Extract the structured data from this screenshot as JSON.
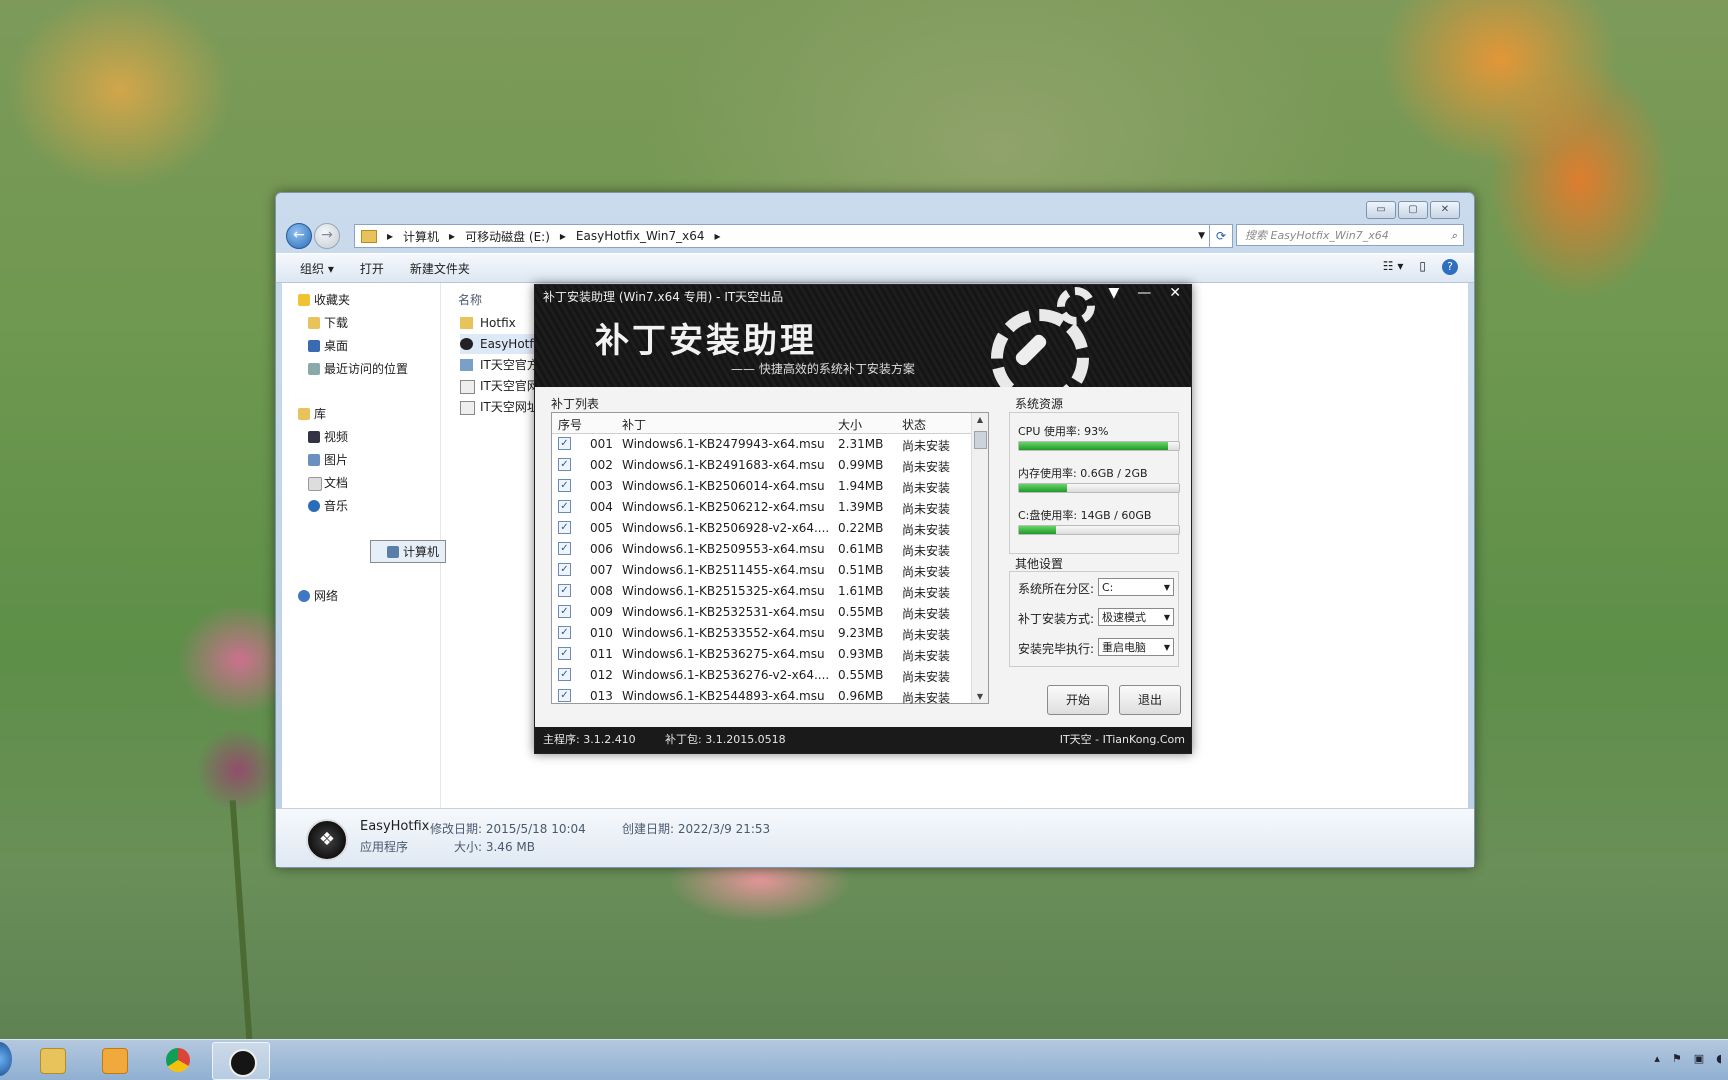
{
  "explorer": {
    "window_controls": [
      "▭",
      "▢",
      "✕"
    ],
    "breadcrumbs": [
      "计算机",
      "可移动磁盘 (E:)",
      "EasyHotfix_Win7_x64"
    ],
    "search_placeholder": "搜索 EasyHotfix_Win7_x64",
    "toolbar": {
      "organize": "组织 ▾",
      "open": "打开",
      "new_folder": "新建文件夹"
    },
    "nav": {
      "favorites": "收藏夹",
      "favorites_items": [
        "下载",
        "桌面",
        "最近访问的位置"
      ],
      "libraries": "库",
      "libraries_items": [
        "视频",
        "图片",
        "文档",
        "音乐"
      ],
      "computer": "计算机",
      "network": "网络"
    },
    "column_name": "名称",
    "files": [
      "Hotfix",
      "EasyHotfi",
      "IT天空官方",
      "IT天空官网",
      "IT天空网址"
    ],
    "details": {
      "name": "EasyHotfix",
      "modified": "修改日期: 2015/5/18 10:04",
      "created": "创建日期: 2022/3/9 21:53",
      "type": "应用程序",
      "size": "大小: 3.46 MB"
    }
  },
  "app": {
    "title": "补丁安装助理 (Win7.x64 专用) - IT天空出品",
    "controls": [
      "▼",
      "—",
      "✕"
    ],
    "big_title": "补丁安装助理",
    "slogan": "—— 快捷高效的系统补丁安装方案",
    "patch_list_label": "补丁列表",
    "columns": {
      "no": "序号",
      "patch": "补丁",
      "size": "大小",
      "status": "状态"
    },
    "patches": [
      {
        "no": "001",
        "name": "Windows6.1-KB2479943-x64.msu",
        "size": "2.31MB",
        "status": "尚未安装"
      },
      {
        "no": "002",
        "name": "Windows6.1-KB2491683-x64.msu",
        "size": "0.99MB",
        "status": "尚未安装"
      },
      {
        "no": "003",
        "name": "Windows6.1-KB2506014-x64.msu",
        "size": "1.94MB",
        "status": "尚未安装"
      },
      {
        "no": "004",
        "name": "Windows6.1-KB2506212-x64.msu",
        "size": "1.39MB",
        "status": "尚未安装"
      },
      {
        "no": "005",
        "name": "Windows6.1-KB2506928-v2-x64....",
        "size": "0.22MB",
        "status": "尚未安装"
      },
      {
        "no": "006",
        "name": "Windows6.1-KB2509553-x64.msu",
        "size": "0.61MB",
        "status": "尚未安装"
      },
      {
        "no": "007",
        "name": "Windows6.1-KB2511455-x64.msu",
        "size": "0.51MB",
        "status": "尚未安装"
      },
      {
        "no": "008",
        "name": "Windows6.1-KB2515325-x64.msu",
        "size": "1.61MB",
        "status": "尚未安装"
      },
      {
        "no": "009",
        "name": "Windows6.1-KB2532531-x64.msu",
        "size": "0.55MB",
        "status": "尚未安装"
      },
      {
        "no": "010",
        "name": "Windows6.1-KB2533552-x64.msu",
        "size": "9.23MB",
        "status": "尚未安装"
      },
      {
        "no": "011",
        "name": "Windows6.1-KB2536275-x64.msu",
        "size": "0.93MB",
        "status": "尚未安装"
      },
      {
        "no": "012",
        "name": "Windows6.1-KB2536276-v2-x64....",
        "size": "0.55MB",
        "status": "尚未安装"
      },
      {
        "no": "013",
        "name": "Windows6.1-KB2544893-x64.msu",
        "size": "0.96MB",
        "status": "尚未安装"
      }
    ],
    "system_resources_label": "系统资源",
    "resources": [
      {
        "label": "CPU 使用率: 93%",
        "fraction": 0.93
      },
      {
        "label": "内存使用率: 0.6GB / 2GB",
        "fraction": 0.3
      },
      {
        "label": "C:盘使用率: 14GB / 60GB",
        "fraction": 0.23
      }
    ],
    "other_settings_label": "其他设置",
    "settings": [
      {
        "label": "系统所在分区:",
        "value": "C:"
      },
      {
        "label": "补丁安装方式:",
        "value": "极速模式"
      },
      {
        "label": "安装完毕执行:",
        "value": "重启电脑"
      }
    ],
    "start_button": "开始",
    "exit_button": "退出",
    "footer": {
      "main": "主程序: 3.1.2.410",
      "pack": "补丁包: 3.1.2015.0518",
      "brand": "IT天空 - ITianKong.Com"
    }
  },
  "colors": {
    "progress": "#1e9a2a",
    "app_header": "#181818",
    "link_blue": "#2c6db9"
  },
  "icons": [
    "back-arrow-icon",
    "forward-arrow-icon",
    "folder-icon",
    "search-icon",
    "refresh-icon",
    "help-icon",
    "star-icon",
    "computer-icon",
    "network-icon",
    "gear-icon",
    "wrench-icon",
    "checkbox-icon",
    "chrome-icon",
    "media-player-icon",
    "explorer-icon",
    "easyhotfix-icon"
  ]
}
